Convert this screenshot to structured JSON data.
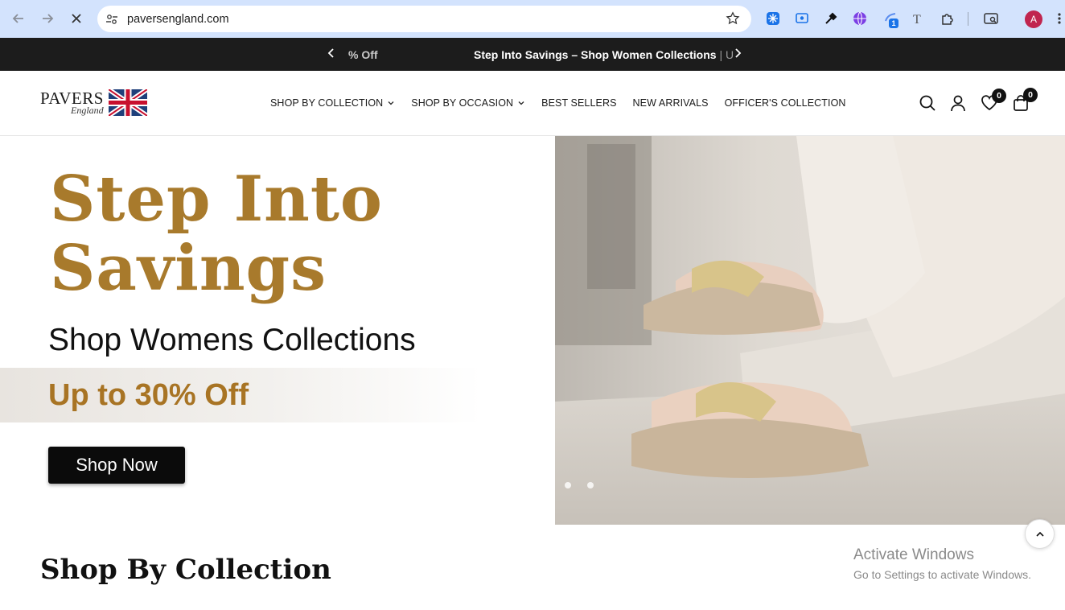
{
  "browser": {
    "url": "paversengland.com",
    "profile_initial": "A",
    "extension_badge": "1"
  },
  "announcement": {
    "left_fragment": "% Off",
    "main_text": "Step Into Savings – Shop Women Collections",
    "separator": "|",
    "trailing": "U"
  },
  "header": {
    "logo_brand": "PAVERS",
    "logo_sub": "England",
    "menu": [
      {
        "label": "SHOP BY COLLECTION"
      },
      {
        "label": "SHOP BY OCCASION"
      },
      {
        "label": "BEST SELLERS"
      },
      {
        "label": "NEW ARRIVALS"
      },
      {
        "label": "OFFICER'S COLLECTION"
      }
    ],
    "wishlist_count": "0",
    "cart_count": "0"
  },
  "hero": {
    "title_line1": "Step Into",
    "title_line2": "Savings",
    "subtitle": "Shop Womens Collections",
    "offer": "Up to 30% Off",
    "cta": "Shop Now"
  },
  "section": {
    "title": "Shop By Collection"
  },
  "watermark": {
    "line1": "Activate Windows",
    "line2": "Go to Settings to activate Windows."
  },
  "colors": {
    "accent_gold": "#a87a2c",
    "announce_bg": "#1c1c1c",
    "chrome_bg": "#d3e3fd"
  }
}
